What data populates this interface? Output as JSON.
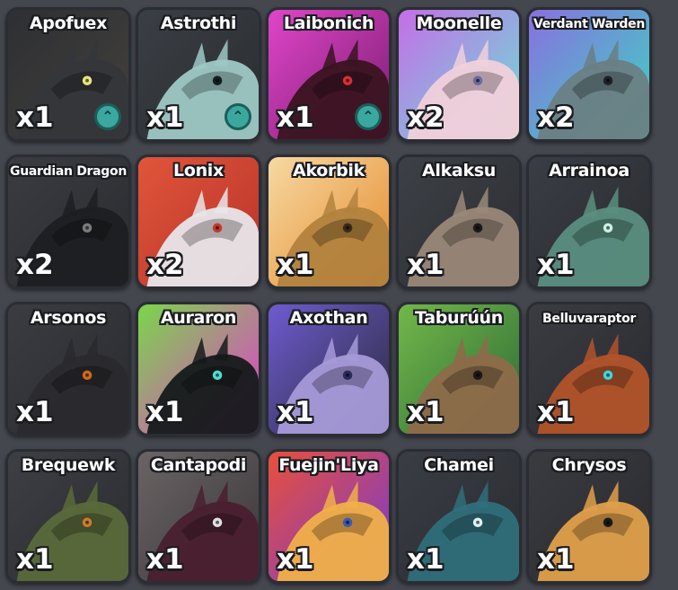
{
  "collection": {
    "cards": [
      {
        "name": "Apofuex",
        "count": "x1",
        "upgrade": true,
        "bg": [
          "#2e2f33",
          "#43413d"
        ],
        "creature": "#35363a",
        "eye": "#e8e67a",
        "icon": "dark-dragon-portrait-icon"
      },
      {
        "name": "Astrothi",
        "count": "x1",
        "upgrade": true,
        "bg": [
          "#3a3f45",
          "#2a2d31"
        ],
        "creature": "#9ec8c4",
        "eye": "#0f1f22",
        "icon": "teal-creature-portrait-icon"
      },
      {
        "name": "Laibonich",
        "count": "x1",
        "upgrade": true,
        "bg": [
          "#e045c9",
          "#7a1e70"
        ],
        "creature": "#3a1420",
        "eye": "#d83030",
        "icon": "red-black-creature-portrait-icon"
      },
      {
        "name": "Moonelle",
        "count": "x2",
        "upgrade": false,
        "bg": [
          "#c56ee8",
          "#6be0d6"
        ],
        "creature": "#f1d0da",
        "eye": "#6a6aa0",
        "icon": "pink-creature-portrait-icon"
      },
      {
        "name": "Verdant Warden",
        "count": "x2",
        "upgrade": false,
        "bg": [
          "#8a6fe0",
          "#3ad7c0"
        ],
        "creature": "#6a7f83",
        "eye": "#1c2326",
        "icon": "antlered-creature-portrait-icon"
      },
      {
        "name": "Guardian Dragon",
        "count": "x2",
        "upgrade": false,
        "bg": [
          "#3b3c41",
          "#2a2b2f"
        ],
        "creature": "#1e1f22",
        "eye": "#7b7b7b",
        "icon": "black-dragon-portrait-icon"
      },
      {
        "name": "Lonix",
        "count": "x2",
        "upgrade": false,
        "bg": [
          "#e0553a",
          "#b7322a"
        ],
        "creature": "#e8e6ea",
        "eye": "#c23a2a",
        "icon": "white-orb-creature-portrait-icon"
      },
      {
        "name": "Akorbik",
        "count": "x1",
        "upgrade": false,
        "bg": [
          "#f6d9a2",
          "#e58a2c"
        ],
        "creature": "#b2823d",
        "eye": "#3a2a1a",
        "icon": "antler-creature-portrait-icon"
      },
      {
        "name": "Alkaksu",
        "count": "x1",
        "upgrade": false,
        "bg": [
          "#3d4046",
          "#2c2e33"
        ],
        "creature": "#9a8878",
        "eye": "#1a1a1a",
        "icon": "spiky-creature-portrait-icon"
      },
      {
        "name": "Arrainoa",
        "count": "x1",
        "upgrade": false,
        "bg": [
          "#3a3d44",
          "#2a2c31"
        ],
        "creature": "#5a8f80",
        "eye": "#c9f0e0",
        "icon": "swirl-creature-portrait-icon"
      },
      {
        "name": "Arsonos",
        "count": "x1",
        "upgrade": false,
        "bg": [
          "#3b3c41",
          "#2a2b2f"
        ],
        "creature": "#2a2a2e",
        "eye": "#d06a1a",
        "icon": "lava-dragon-portrait-icon"
      },
      {
        "name": "Auraron",
        "count": "x1",
        "upgrade": false,
        "bg": [
          "#7bd64a",
          "#e33ad0"
        ],
        "creature": "#151a1a",
        "eye": "#4ae0d0",
        "icon": "aurora-dragon-portrait-icon"
      },
      {
        "name": "Axothan",
        "count": "x1",
        "upgrade": false,
        "bg": [
          "#6e5bd0",
          "#2a2a3a"
        ],
        "creature": "#a79ad8",
        "eye": "#2a2a5a",
        "icon": "axolotl-creature-portrait-icon"
      },
      {
        "name": "Taburúún",
        "count": "x1",
        "upgrade": false,
        "bg": [
          "#72b84a",
          "#2d6b36"
        ],
        "creature": "#8e6a4a",
        "eye": "#1a1a1a",
        "icon": "beast-creature-portrait-icon"
      },
      {
        "name": "Belluvaraptor",
        "count": "x1",
        "upgrade": false,
        "bg": [
          "#3a3c42",
          "#2a2b30"
        ],
        "creature": "#b2542a",
        "eye": "#3ad8e0",
        "icon": "raptor-creature-portrait-icon"
      },
      {
        "name": "Brequewk",
        "count": "x1",
        "upgrade": false,
        "bg": [
          "#3d3f44",
          "#2a2c30"
        ],
        "creature": "#5a6a3a",
        "eye": "#d07a2a",
        "icon": "bird-creature-portrait-icon"
      },
      {
        "name": "Cantapodi",
        "count": "x1",
        "upgrade": false,
        "bg": [
          "#6a6465",
          "#3a3638"
        ],
        "creature": "#4a1f2f",
        "eye": "#e0e0e0",
        "icon": "horned-creature-portrait-icon"
      },
      {
        "name": "Fuejin'Liya",
        "count": "x1",
        "upgrade": false,
        "bg": [
          "#e8503a",
          "#7a3ad0"
        ],
        "creature": "#f0b04a",
        "eye": "#3a5ab0",
        "icon": "fire-creature-portrait-icon"
      },
      {
        "name": "Chamei",
        "count": "x1",
        "upgrade": false,
        "bg": [
          "#3a3d44",
          "#2a2c31"
        ],
        "creature": "#2f6f7a",
        "eye": "#e0f0f0",
        "icon": "aquatic-creature-portrait-icon"
      },
      {
        "name": "Chrysos",
        "count": "x1",
        "upgrade": false,
        "bg": [
          "#3a3b40",
          "#2a2b2f"
        ],
        "creature": "#e0a04a",
        "eye": "#1a1a1a",
        "icon": "golden-dragon-portrait-icon"
      }
    ]
  }
}
